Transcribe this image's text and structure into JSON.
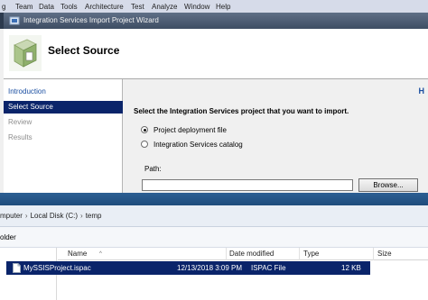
{
  "vs_menubar": {
    "items": [
      "g",
      "Team",
      "Data",
      "Tools",
      "Architecture",
      "Test",
      "Analyze",
      "Window",
      "Help"
    ]
  },
  "wizard": {
    "title": "Integration Services Import Project Wizard",
    "header_title": "Select Source",
    "nav": [
      {
        "label": "Introduction",
        "state": "link"
      },
      {
        "label": "Select Source",
        "state": "selected"
      },
      {
        "label": "Review",
        "state": "disabled"
      },
      {
        "label": "Results",
        "state": "disabled"
      }
    ],
    "help_glyph": "H",
    "instruction": "Select the Integration Services project that you want to import.",
    "options": [
      {
        "label": "Project deployment file",
        "checked": true
      },
      {
        "label": "Integration Services catalog",
        "checked": false
      }
    ],
    "path_label": "Path:",
    "path_value": "",
    "browse_label": "Browse..."
  },
  "explorer": {
    "breadcrumb": [
      "mputer",
      "Local Disk (C:)",
      "temp"
    ],
    "toolbar_text": "older",
    "columns": [
      "Name",
      "Date modified",
      "Type",
      "Size"
    ],
    "files": [
      {
        "name": "MySSISProject.ispac",
        "date_modified": "12/13/2018 3:09 PM",
        "type": "ISPAC File",
        "size": "12 KB"
      }
    ]
  },
  "colors": {
    "selection": "#0a246a",
    "link": "#1a4ea1",
    "titlebar": "#4a5a72"
  }
}
